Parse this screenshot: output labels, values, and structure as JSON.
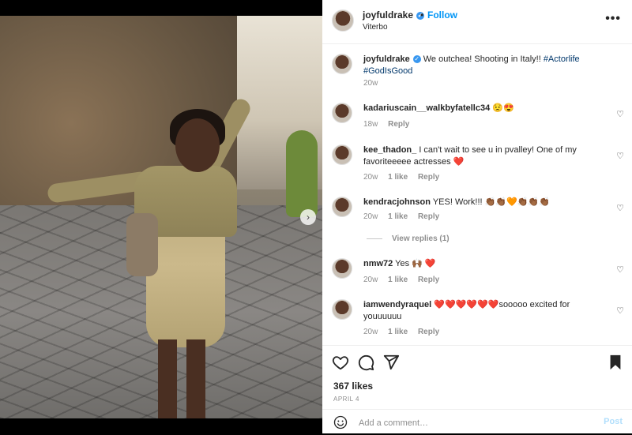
{
  "post": {
    "username": "joyfuldrake",
    "follow_label": "Follow",
    "separator": "•",
    "location": "Viterbo",
    "more_label": "•••",
    "next_arrow": "›"
  },
  "caption": {
    "username": "joyfuldrake",
    "text": "We outchea! Shooting in Italy!! ",
    "hashtag1": "#Actorlife",
    "hashtag2": "#GodIsGood",
    "time": "20w"
  },
  "comments": [
    {
      "username": "kadariuscain__walkbyfatellc34",
      "text": "😟😍",
      "time": "18w",
      "likes": "",
      "reply": "Reply"
    },
    {
      "username": "kee_thadon_",
      "text": "I can't wait to see u in pvalley! One of my favoriteeeee actresses ❤️",
      "time": "20w",
      "likes": "1 like",
      "reply": "Reply"
    },
    {
      "username": "kendracjohnson",
      "text": "YES! Work!!! 👏🏾👏🏾🧡👏🏾👏🏾👏🏾",
      "time": "20w",
      "likes": "1 like",
      "reply": "Reply"
    },
    {
      "username": "nmw72",
      "text": "Yes 🙌🏾 ❤️",
      "time": "20w",
      "likes": "1 like",
      "reply": "Reply"
    },
    {
      "username": "iamwendyraquel",
      "text": "❤️❤️❤️❤️❤️❤️sooooo excited for youuuuuu",
      "time": "20w",
      "likes": "1 like",
      "reply": "Reply"
    }
  ],
  "view_replies": "View replies (1)",
  "likes_count": "367 likes",
  "date": "APRIL 4",
  "add_comment": {
    "placeholder": "Add a comment…",
    "post_label": "Post"
  },
  "colors": {
    "link_blue": "#0095f6",
    "hashtag": "#00376b",
    "muted": "#8e8e8e",
    "verified": "#3897f0",
    "post_disabled": "#b2dffc"
  },
  "icons": {
    "like": "heart-outline-icon",
    "comment": "comment-bubble-icon",
    "share": "paper-plane-icon",
    "save": "bookmark-icon",
    "emoji": "smiley-icon",
    "verified": "verified-badge-icon"
  }
}
